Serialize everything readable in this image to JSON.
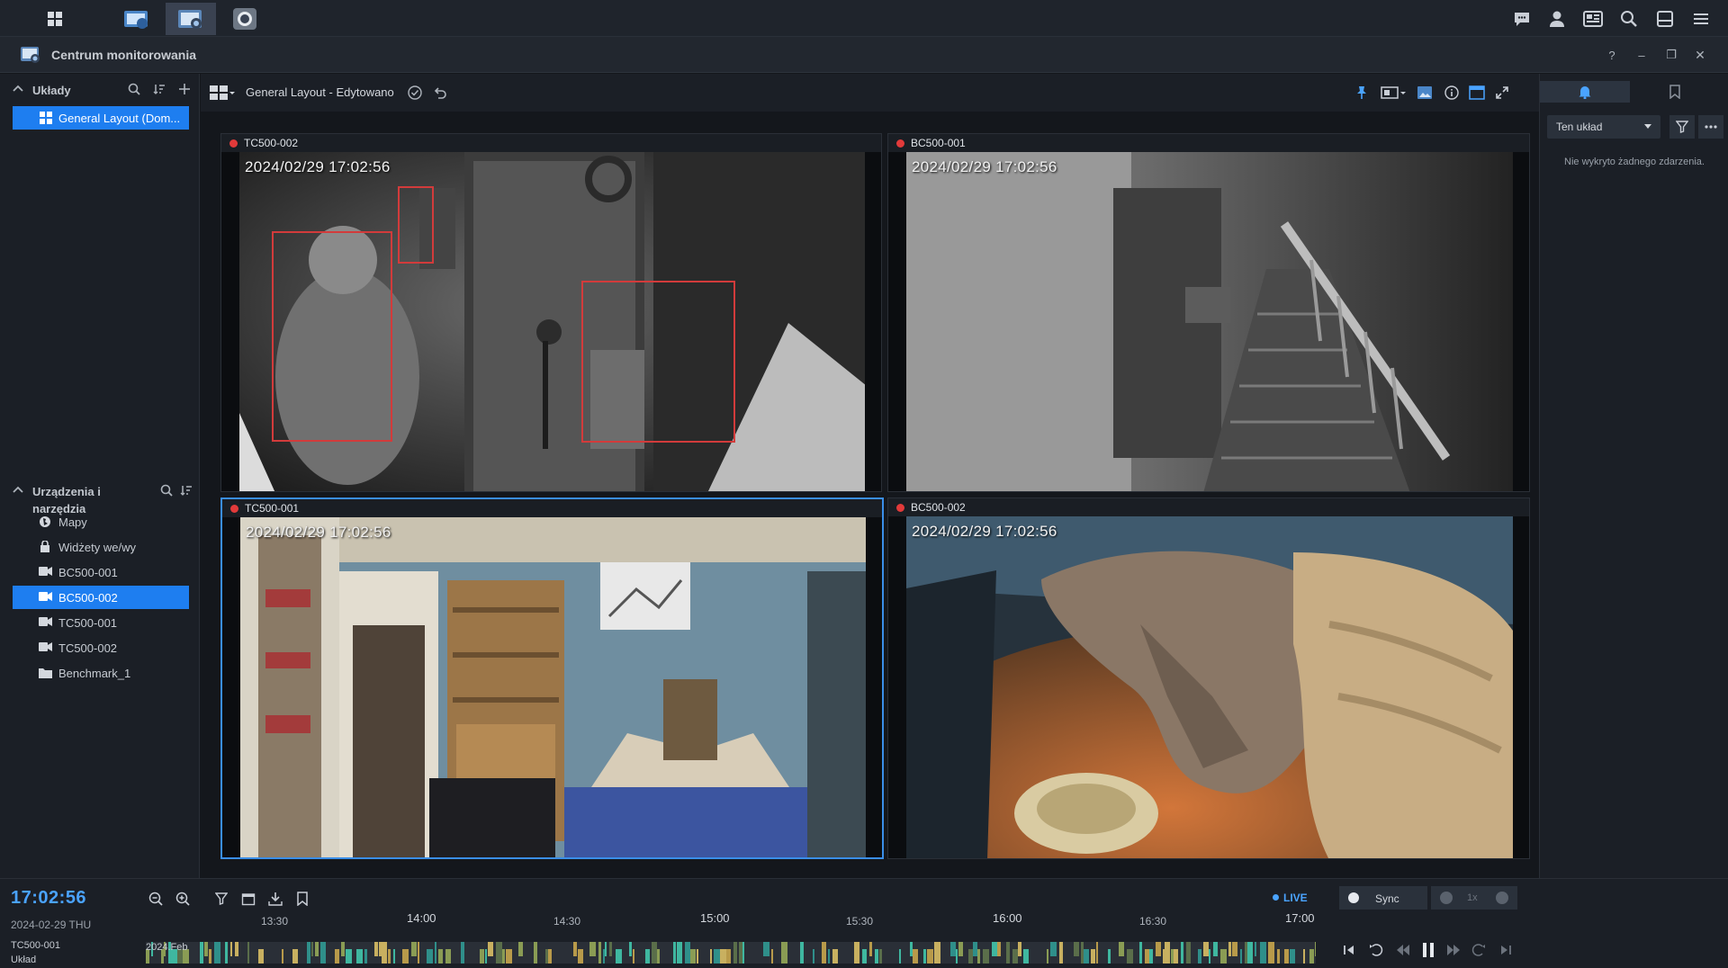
{
  "window": {
    "title": "Centrum monitorowania",
    "help": "?",
    "minimize": "–",
    "restore": "❐",
    "close": "✕"
  },
  "left_panel": {
    "layouts_section": {
      "label": "Układy"
    },
    "layout_items": [
      {
        "label": "General Layout (Dom..."
      }
    ],
    "devices_section": {
      "label": "Urządzenia i narzędzia"
    },
    "device_items": [
      {
        "label": "Mapy",
        "icon": "map-icon"
      },
      {
        "label": "Widżety we/wy",
        "icon": "widget-icon"
      },
      {
        "label": "BC500-001",
        "icon": "camera-icon"
      },
      {
        "label": "BC500-002",
        "icon": "camera-icon",
        "selected": true
      },
      {
        "label": "TC500-001",
        "icon": "camera-icon"
      },
      {
        "label": "TC500-002",
        "icon": "camera-icon"
      },
      {
        "label": "Benchmark_1",
        "icon": "folder-icon"
      }
    ]
  },
  "viewbar": {
    "layout_name": "General Layout - Edytowano"
  },
  "cameras": [
    {
      "name": "TC500-002",
      "timestamp": "2024/02/29 17:02:56"
    },
    {
      "name": "BC500-001",
      "timestamp": "2024/02/29 17:02:56"
    },
    {
      "name": "TC500-001",
      "timestamp": "2024/02/29 17:02:56"
    },
    {
      "name": "BC500-002",
      "timestamp": "2024/02/29 17:02:56"
    }
  ],
  "right_panel": {
    "scope_select": "Ten układ",
    "no_events": "Nie wykryto żadnego zdarzenia."
  },
  "timeline": {
    "clock": "17:02:56",
    "date": "2024-02-29 THU",
    "track_name": "TC500-001",
    "track_sub": "Układ",
    "track_date": "2024.Feb",
    "live": "LIVE",
    "sync": "Sync",
    "speed": "1x",
    "major_ticks": [
      "14:00",
      "15:00",
      "16:00",
      "17:00"
    ],
    "minor_ticks": [
      "13:30",
      "14:30",
      "15:30",
      "16:30"
    ]
  },
  "colors": {
    "accent": "#1e7ef0",
    "live": "#4aa3ff",
    "recording": "#e23a3a",
    "detection_box": "#d23b3b"
  }
}
